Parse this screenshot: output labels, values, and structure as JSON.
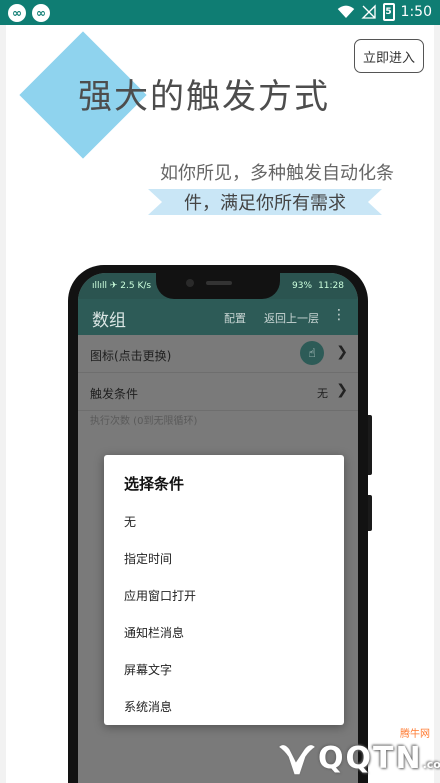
{
  "status_bar": {
    "left_icons": [
      "infinity-icon",
      "infinity-icon"
    ],
    "time": "1:50",
    "battery_level": "5",
    "icons": [
      "wifi-icon",
      "no-signal-icon",
      "battery-icon"
    ]
  },
  "promo": {
    "enter_button": "立即进入",
    "headline": "强大的触发方式",
    "subtitle_line1": "如你所见，多种触发自动化条",
    "subtitle_line2": "件，满足你所有需求"
  },
  "phone": {
    "status_left": "ıllıll ✈ 2.5 K/s",
    "battery": "93%",
    "time": "11:28",
    "app_bar": {
      "title": "数组",
      "action_config": "配置",
      "action_back": "返回上一层",
      "more": "⋮"
    },
    "rows": {
      "icon_label": "图标(点击更换)",
      "trigger_label": "触发条件",
      "trigger_value": "无",
      "exec_hint": "执行次数 (0到无限循环)"
    },
    "dialog": {
      "title": "选择条件",
      "items": [
        "无",
        "指定时间",
        "应用窗口打开",
        "通知栏消息",
        "屏幕文字",
        "系统消息"
      ]
    }
  },
  "watermark": {
    "top_text": "腾牛网",
    "logo_text": "QQTN",
    "logo_suffix": ".com"
  },
  "colors": {
    "status_bar": "#0f7d73",
    "diamond": "#8fd3ee",
    "ribbon": "#c9e6f6",
    "app_bar": "#2d5b57"
  }
}
